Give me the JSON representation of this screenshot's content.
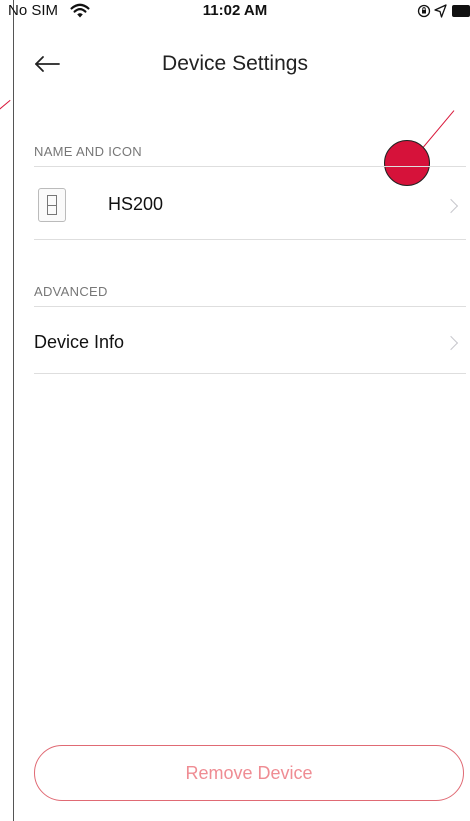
{
  "status_bar": {
    "carrier": "No SIM",
    "time": "11:02 AM",
    "icons": [
      "wifi-icon",
      "lock-icon",
      "location-icon",
      "battery-icon"
    ]
  },
  "header": {
    "title": "Device Settings",
    "back_icon": "arrow-left-icon"
  },
  "sections": {
    "name_and_icon": {
      "header": "NAME AND ICON",
      "device_name": "HS200",
      "device_icon": "wall-switch-icon"
    },
    "advanced": {
      "header": "ADVANCED",
      "device_info_label": "Device Info"
    }
  },
  "actions": {
    "remove_label": "Remove Device"
  },
  "colors": {
    "remove_border": "#e06a74",
    "remove_text": "#ef8c93",
    "annotation": "#d6123a"
  }
}
